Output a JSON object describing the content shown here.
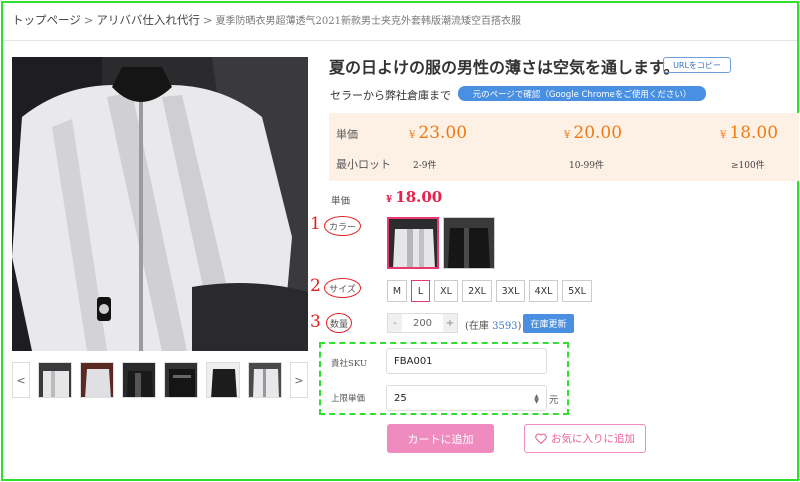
{
  "breadcrumb": {
    "items": [
      "トップページ",
      "アリババ仕入れ代行"
    ],
    "separator": ">",
    "current": "夏季防晒衣男超薄透气2021新款男士夹克外套韩版潮流矮空百搭衣服"
  },
  "product": {
    "title": "夏の日よけの服の男性の薄さは空気を通します。",
    "url_copy_label": "URLをコピー",
    "seller_text": "セラーから弊社倉庫まで",
    "source_button_label": "元のページで確認（Google Chromeをご使用ください）"
  },
  "price_table": {
    "price_label": "単価",
    "min_lot_label": "最小ロット",
    "currency": "¥",
    "tiers": [
      {
        "price": "23.00",
        "qty": "2-9件"
      },
      {
        "price": "20.00",
        "qty": "10-99件"
      },
      {
        "price": "18.00",
        "qty": "≥100件"
      }
    ]
  },
  "selection": {
    "unit_price_label": "単価",
    "unit_price_currency": "¥",
    "unit_price": "18.00",
    "color_label": "カラー",
    "size_label": "サイズ",
    "quantity_label": "数量",
    "annotations": [
      "1",
      "2",
      "3"
    ],
    "sizes": [
      "M",
      "L",
      "XL",
      "2XL",
      "3XL",
      "4XL",
      "5XL"
    ],
    "selected_size": "L",
    "quantity_minus": "-",
    "quantity_value": "200",
    "quantity_plus": "+",
    "stock_prefix": "(在庫",
    "stock_count": "3593",
    "stock_suffix": ")",
    "refresh_label": "在庫更新"
  },
  "custom_fields": {
    "sku_label": "貴社SKU",
    "sku_value": "FBA001",
    "max_price_label": "上限単価",
    "max_price_value": "25",
    "max_price_unit": "元"
  },
  "actions": {
    "cart_label": "カートに追加",
    "favorite_label": "お気に入りに追加"
  },
  "gallery": {
    "prev": "<",
    "next": ">"
  },
  "colors": {
    "accent_orange": "#f07a12",
    "accent_pink": "#e8204c",
    "frame_green": "#2fe02f",
    "annotation_red": "#e02020"
  }
}
